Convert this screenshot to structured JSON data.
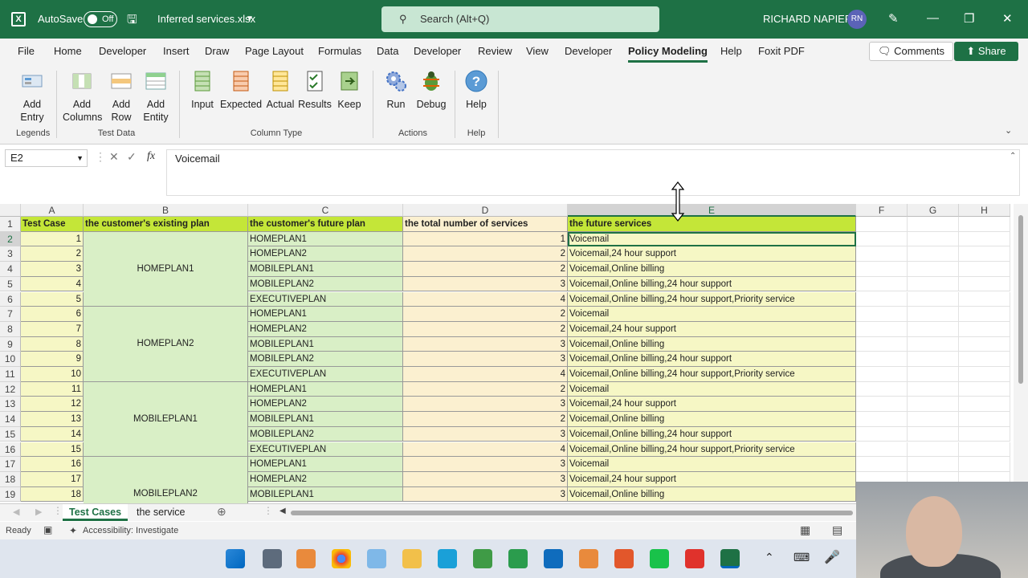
{
  "titlebar": {
    "autosave_label": "AutoSave",
    "autosave_state": "Off",
    "filename": "Inferred services.xlsx",
    "search_placeholder": "Search (Alt+Q)",
    "user_name": "RICHARD NAPIER",
    "user_initials": "RN"
  },
  "menu": {
    "items": [
      "File",
      "Home",
      "Developer",
      "Insert",
      "Draw",
      "Page Layout",
      "Formulas",
      "Data",
      "Developer",
      "Review",
      "View",
      "Developer",
      "Policy Modeling",
      "Help",
      "Foxit PDF"
    ],
    "active": "Policy Modeling",
    "comments": "Comments",
    "share": "Share"
  },
  "ribbon": {
    "buttons": [
      {
        "label": "Add\nEntry"
      },
      {
        "label": "Add\nColumns"
      },
      {
        "label": "Add\nRow"
      },
      {
        "label": "Add\nEntity"
      },
      {
        "label": "Input"
      },
      {
        "label": "Expected"
      },
      {
        "label": "Actual"
      },
      {
        "label": "Results"
      },
      {
        "label": "Keep"
      },
      {
        "label": "Run"
      },
      {
        "label": "Debug"
      },
      {
        "label": "Help"
      }
    ],
    "groups": [
      "Legends",
      "Test Data",
      "Column Type",
      "Actions",
      "Help"
    ]
  },
  "formula": {
    "name_box": "E2",
    "value": "Voicemail",
    "fx": "fx"
  },
  "columns": [
    "A",
    "B",
    "C",
    "D",
    "E",
    "F",
    "G",
    "H"
  ],
  "selected_column": "E",
  "header_row": [
    "Test Case",
    "the customer's existing plan",
    "the customer's future plan",
    "the total number of services",
    "the future services"
  ],
  "rows": [
    {
      "r": "2",
      "a": "1",
      "c": "HOMEPLAN1",
      "d": "1",
      "e": "Voicemail"
    },
    {
      "r": "3",
      "a": "2",
      "c": "HOMEPLAN2",
      "d": "2",
      "e": "Voicemail,24 hour support"
    },
    {
      "r": "4",
      "a": "3",
      "c": "MOBILEPLAN1",
      "d": "2",
      "e": "Voicemail,Online billing"
    },
    {
      "r": "5",
      "a": "4",
      "c": "MOBILEPLAN2",
      "d": "3",
      "e": "Voicemail,Online billing,24 hour support"
    },
    {
      "r": "6",
      "a": "5",
      "c": "EXECUTIVEPLAN",
      "d": "4",
      "e": "Voicemail,Online billing,24 hour support,Priority service"
    },
    {
      "r": "7",
      "a": "6",
      "c": "HOMEPLAN1",
      "d": "2",
      "e": "Voicemail"
    },
    {
      "r": "8",
      "a": "7",
      "c": "HOMEPLAN2",
      "d": "2",
      "e": "Voicemail,24 hour support"
    },
    {
      "r": "9",
      "a": "8",
      "c": "MOBILEPLAN1",
      "d": "3",
      "e": "Voicemail,Online billing"
    },
    {
      "r": "10",
      "a": "9",
      "c": "MOBILEPLAN2",
      "d": "3",
      "e": "Voicemail,Online billing,24 hour support"
    },
    {
      "r": "11",
      "a": "10",
      "c": "EXECUTIVEPLAN",
      "d": "4",
      "e": "Voicemail,Online billing,24 hour support,Priority service"
    },
    {
      "r": "12",
      "a": "11",
      "c": "HOMEPLAN1",
      "d": "2",
      "e": "Voicemail"
    },
    {
      "r": "13",
      "a": "12",
      "c": "HOMEPLAN2",
      "d": "3",
      "e": "Voicemail,24 hour support"
    },
    {
      "r": "14",
      "a": "13",
      "c": "MOBILEPLAN1",
      "d": "2",
      "e": "Voicemail,Online billing"
    },
    {
      "r": "15",
      "a": "14",
      "c": "MOBILEPLAN2",
      "d": "3",
      "e": "Voicemail,Online billing,24 hour support"
    },
    {
      "r": "16",
      "a": "15",
      "c": "EXECUTIVEPLAN",
      "d": "4",
      "e": "Voicemail,Online billing,24 hour support,Priority service"
    },
    {
      "r": "17",
      "a": "16",
      "c": "HOMEPLAN1",
      "d": "3",
      "e": "Voicemail"
    },
    {
      "r": "18",
      "a": "17",
      "c": "HOMEPLAN2",
      "d": "3",
      "e": "Voicemail,24 hour support"
    },
    {
      "r": "19",
      "a": "18",
      "c": "MOBILEPLAN1",
      "d": "3",
      "e": "Voicemail,Online billing"
    }
  ],
  "existing_plans": [
    "HOMEPLAN1",
    "HOMEPLAN2",
    "MOBILEPLAN1",
    "MOBILEPLAN2"
  ],
  "sheet_tabs": [
    "Test Cases",
    "the service"
  ],
  "active_sheet": "Test Cases",
  "status": {
    "ready": "Ready",
    "accessibility": "Accessibility: Investigate"
  },
  "colors": {
    "excel_green": "#1e7145",
    "header_fill": "#c4e638",
    "plan_fill": "#d9efc6",
    "services_fill": "#f6f7c5",
    "count_fill": "#fbf0d0"
  }
}
